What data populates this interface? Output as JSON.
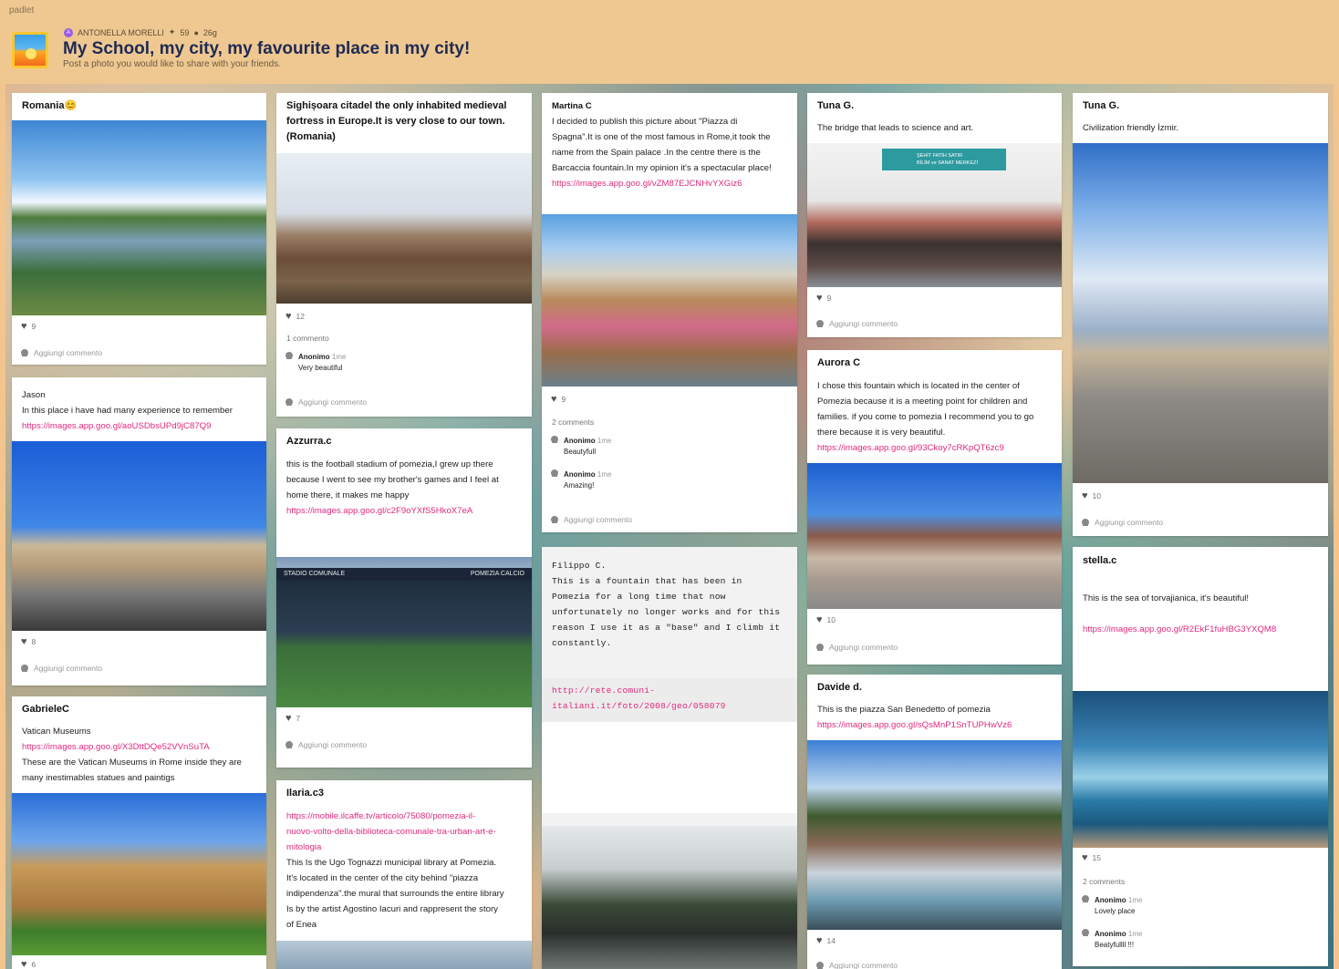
{
  "app": {
    "brand": "padlet"
  },
  "header": {
    "author": "ANTONELLA MORELLI",
    "author_initial": "A",
    "likes": "59",
    "age": "26g",
    "title": "My School, my city, my favourite place in my city!",
    "subtitle": "Post a photo you would like to share with your friends."
  },
  "labels": {
    "add_comment": "Aggiungi commento",
    "comment_1": "1 commento",
    "comments_2": "2 comments"
  },
  "icons": {
    "like": "heart-icon",
    "user": "user-icon",
    "logo": "sunset-icon"
  },
  "colors": {
    "accent": "#e0297e",
    "header_bg": "#efc891",
    "title": "#1f2a55"
  },
  "posts": {
    "romania": {
      "title": "Romania😊",
      "likes": "9"
    },
    "jason": {
      "author": "Jason",
      "text": "In this place i have had many experience to remember",
      "link": "https://images.app.goo.gl/aoUSDbsUPd9jC87Q9",
      "likes": "8"
    },
    "gabriele": {
      "title": "GabrieleC",
      "line1": "Vatican Museums",
      "link": "https://images.app.goo.gl/X3DttDQe52VVnSuTA",
      "text1": "These are the Vatican Museums in Rome  inside they are",
      "text2": "many inestimables statues and paintigs",
      "likes": "6"
    },
    "sighisoara": {
      "title1": "Sighișoara citadel the only inhabited medieval",
      "title2": "fortress in Europe.It is very close to our town.",
      "title3": "(Romania)",
      "likes": "12",
      "comment_author": "Anonimo",
      "comment_time": "1me",
      "comment_text": "Very beautiful"
    },
    "azzurra": {
      "title": "Azzurra.c",
      "text1": "this is the football stadium of pomezia,I grew up there",
      "text2": "because I went to see my brother's games and I feel at",
      "text3": "home there, it makes me happy",
      "link": "https://images.app.goo.gl/c2F9oYXfS5HkoX7eA",
      "banner_left": "STADIO COMUNALE",
      "banner_right": "POMEZIA CALCIO",
      "likes": "7"
    },
    "ilaria": {
      "title": "Ilaria.c3",
      "link1": "https://mobile.ilcaffe.tv/articolo/75080/pomezia-il-",
      "link2": "nuovo-volto-della-biblioteca-comunale-tra-urban-art-e-",
      "link3": "mitologia",
      "text1": "This Is the Ugo Tognazzi municipal library at Pomezia.",
      "text2": "It's located in the center of the city behind \"piazza",
      "text3": "indipendenza\".the mural that surrounds the entire library",
      "text4": "Is by the artist Agostino Iacuri and rappresent the story",
      "text5": "of Enea"
    },
    "martina": {
      "title": "Martina C",
      "text1": "I decided to publish this picture about \"Piazza di",
      "text2": "Spagna\".It is one of the most famous in Rome,it took the",
      "text3": "name from the Spain palace .In the centre there is the",
      "text4": "Barcaccia fountain.In my opinion it's a spectacular place!",
      "link": "https://images.app.goo.gl/vZM87EJCNHvYXGiz6",
      "likes": "9",
      "c1_author": "Anonimo",
      "c1_time": "1me",
      "c1_text": "Beautyfull",
      "c2_author": "Anonimo",
      "c2_time": "1me",
      "c2_text": "Amazing!"
    },
    "filippo": {
      "line1": "Filippo C.",
      "line2": "This is a fountain that has been in",
      "line3": "Pomezia for a long time that now",
      "line4": "unfortunately no longer works and for this",
      "line5": "reason I use it as a \"base\" and I climb it",
      "line6": "constantly.",
      "link1": "http://rete.comuni-",
      "link2": "italiani.it/foto/2008/geo/058079"
    },
    "tuna1": {
      "title": "Tuna G.",
      "text": "The bridge that leads to science and art.",
      "sign1": "ŞEHİT FATİH SATIR",
      "sign2": "BİLİM ve SANAT MERKEZİ",
      "likes": "9"
    },
    "aurora": {
      "title": "Aurora C",
      "text1": "I chose this fountain which is located in the center of",
      "text2": "Pomezia because it is a meeting point for children and",
      "text3": "families.  if you come to pomezia I recommend you to go",
      "text4": "there because it is very beautiful.",
      "link": "https://images.app.goo.gl/93Ckoy7cRKpQT6zc9",
      "likes": "10"
    },
    "davide": {
      "title": "Davide d.",
      "text": "This is the piazza San Benedetto of pomezia",
      "link": "https://images.app.goo.gl/sQsMnP1SnTUPHwVz6",
      "likes": "14"
    },
    "tuna2": {
      "title": "Tuna G.",
      "text": "Civilization friendly İzmir.",
      "likes": "10"
    },
    "stella": {
      "title": "stella.c",
      "text": "This is the sea of torvajianica, it's beautiful!",
      "link": "https://images.app.goo.gl/R2EkF1fuHBG3YXQM8",
      "likes": "15",
      "c1_author": "Anonimo",
      "c1_time": "1me",
      "c1_text": "Lovely place",
      "c2_author": "Anonimo",
      "c2_time": "1me",
      "c2_text": "Beatyfullll !!!"
    }
  }
}
